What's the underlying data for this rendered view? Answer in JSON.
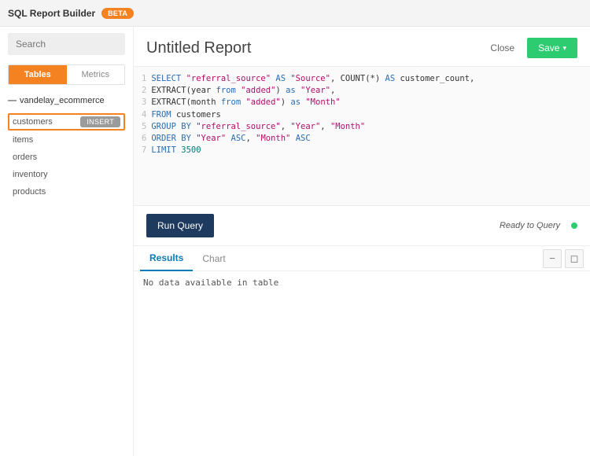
{
  "topbar": {
    "title": "SQL Report Builder",
    "badge": "BETA"
  },
  "sidebar": {
    "search_placeholder": "Search",
    "tabs": {
      "tables": "Tables",
      "metrics": "Metrics"
    },
    "db_name": "vandelay_ecommerce",
    "insert_label": "INSERT",
    "tables": [
      {
        "name": "customers",
        "selected": true
      },
      {
        "name": "items",
        "selected": false
      },
      {
        "name": "orders",
        "selected": false
      },
      {
        "name": "inventory",
        "selected": false
      },
      {
        "name": "products",
        "selected": false
      }
    ]
  },
  "header": {
    "title": "Untitled Report",
    "close": "Close",
    "save": "Save"
  },
  "editor": {
    "lines": [
      {
        "n": "1",
        "tokens": [
          [
            "kw",
            "SELECT "
          ],
          [
            "str",
            "\"referral_source\""
          ],
          [
            "kw",
            " AS "
          ],
          [
            "str",
            "\"Source\""
          ],
          [
            "pl",
            ", "
          ],
          [
            "fn",
            "COUNT"
          ],
          [
            "pl",
            "("
          ],
          [
            "pl",
            "*"
          ],
          [
            "pl",
            ") "
          ],
          [
            "kw",
            "AS "
          ],
          [
            "id",
            "customer_count"
          ],
          [
            "pl",
            ","
          ]
        ]
      },
      {
        "n": "2",
        "tokens": [
          [
            "fn",
            "EXTRACT"
          ],
          [
            "pl",
            "("
          ],
          [
            "id",
            "year"
          ],
          [
            "kw",
            " from "
          ],
          [
            "str",
            "\"added\""
          ],
          [
            "pl",
            ") "
          ],
          [
            "kw",
            "as "
          ],
          [
            "str",
            "\"Year\""
          ],
          [
            "pl",
            ","
          ]
        ]
      },
      {
        "n": "3",
        "tokens": [
          [
            "fn",
            "EXTRACT"
          ],
          [
            "pl",
            "("
          ],
          [
            "id",
            "month"
          ],
          [
            "kw",
            " from "
          ],
          [
            "str",
            "\"added\""
          ],
          [
            "pl",
            ") "
          ],
          [
            "kw",
            "as "
          ],
          [
            "str",
            "\"Month\""
          ]
        ]
      },
      {
        "n": "4",
        "tokens": [
          [
            "kw",
            "FROM "
          ],
          [
            "id",
            "customers"
          ]
        ]
      },
      {
        "n": "5",
        "tokens": [
          [
            "kw",
            "GROUP BY "
          ],
          [
            "str",
            "\"referral_source\""
          ],
          [
            "pl",
            ", "
          ],
          [
            "str",
            "\"Year\""
          ],
          [
            "pl",
            ", "
          ],
          [
            "str",
            "\"Month\""
          ]
        ]
      },
      {
        "n": "6",
        "tokens": [
          [
            "kw",
            "ORDER BY "
          ],
          [
            "str",
            "\"Year\""
          ],
          [
            "kw",
            " ASC"
          ],
          [
            "pl",
            ", "
          ],
          [
            "str",
            "\"Month\""
          ],
          [
            "kw",
            " ASC"
          ]
        ]
      },
      {
        "n": "7",
        "tokens": [
          [
            "kw",
            "LIMIT "
          ],
          [
            "num",
            "3500"
          ]
        ]
      }
    ]
  },
  "runbar": {
    "run": "Run Query",
    "status": "Ready to Query"
  },
  "results": {
    "tabs": {
      "results": "Results",
      "chart": "Chart"
    },
    "no_data": "No data available in table"
  }
}
